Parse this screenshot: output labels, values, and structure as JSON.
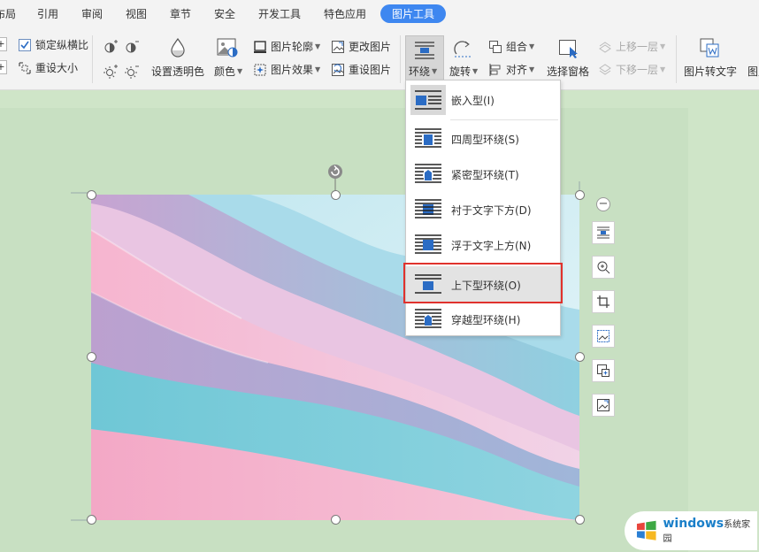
{
  "tabs": [
    "布局",
    "引用",
    "审阅",
    "视图",
    "章节",
    "安全",
    "开发工具",
    "特色应用",
    "图片工具"
  ],
  "ribbon": {
    "lock_ratio": "锁定纵横比",
    "reset_size": "重设大小",
    "set_transparent": "设置透明色",
    "color": "颜色",
    "outline": "图片轮廓",
    "effects": "图片效果",
    "change_picture": "更改图片",
    "reset_picture": "重设图片",
    "wrap": "环绕",
    "rotate": "旋转",
    "group": "组合",
    "align": "对齐",
    "selection_pane": "选择窗格",
    "bring_forward": "上移一层",
    "send_backward": "下移一层",
    "pic_to_text": "图片转文字",
    "more": "图片"
  },
  "wrap_menu": {
    "items": [
      "嵌入型(I)",
      "四周型环绕(S)",
      "紧密型环绕(T)",
      "衬于文字下方(D)",
      "浮于文字上方(N)",
      "上下型环绕(O)",
      "穿越型环绕(H)"
    ],
    "hovered_index": 5
  },
  "watermark": {
    "brand": "windows",
    "site": "系统家园"
  },
  "colors": {
    "accent": "#3e87f0",
    "highlight": "#e0322d",
    "page_bg": "#cfe5c8"
  }
}
